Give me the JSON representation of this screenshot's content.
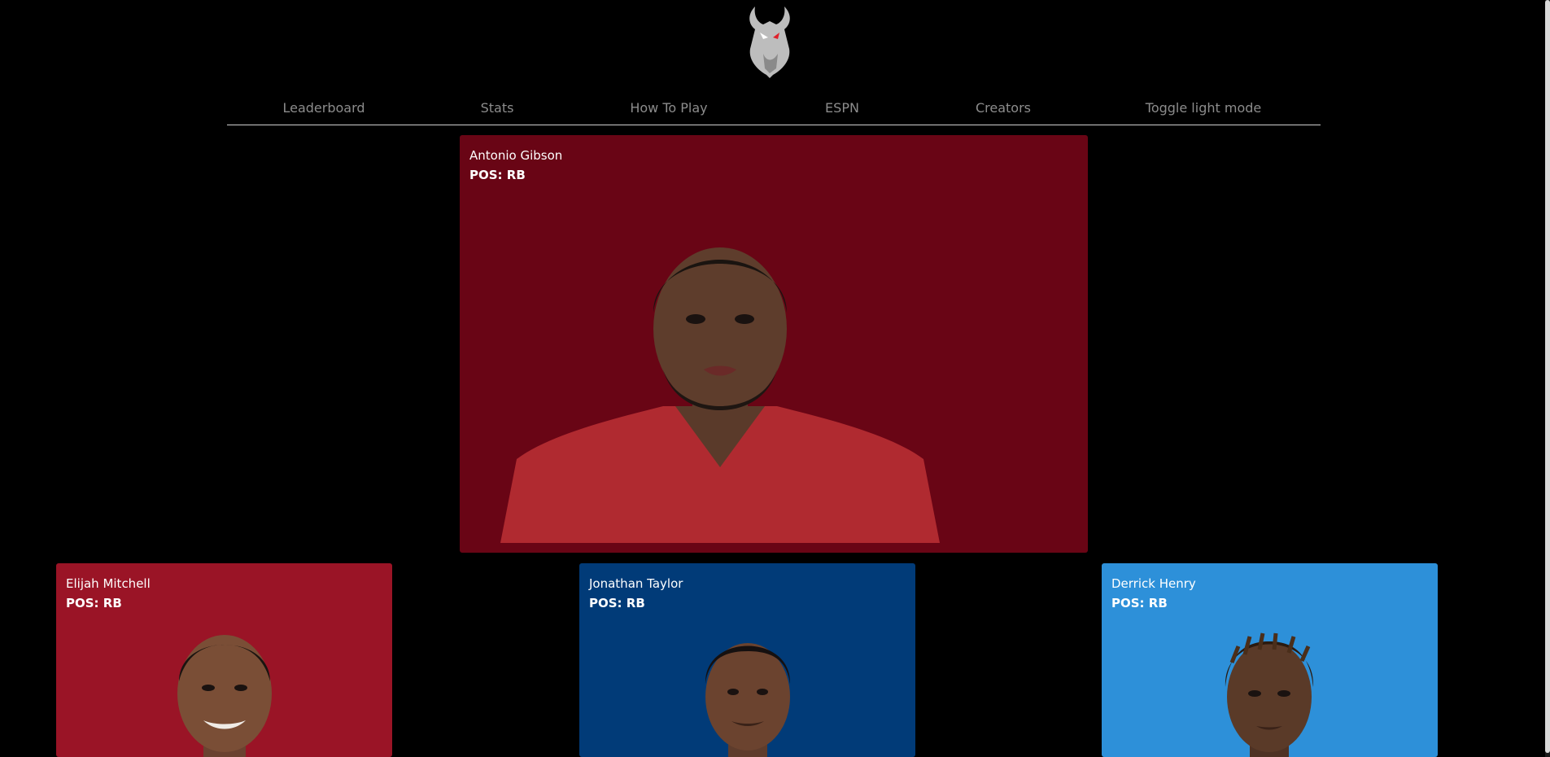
{
  "app": {
    "logo_icon": "goat-logo-icon"
  },
  "nav": {
    "items": [
      {
        "label": "Leaderboard"
      },
      {
        "label": "Stats"
      },
      {
        "label": "How To Play"
      },
      {
        "label": "ESPN"
      },
      {
        "label": "Creators"
      },
      {
        "label": "Toggle light mode"
      }
    ]
  },
  "featured": {
    "name": "Antonio Gibson",
    "position": "POS: RB",
    "background": "#690515",
    "jersey": "#b02a30"
  },
  "options": [
    {
      "name": "Elijah Mitchell",
      "position": "POS: RB",
      "background": "#9a1426",
      "jersey": "#b31e2e"
    },
    {
      "name": "Jonathan Taylor",
      "position": "POS: RB",
      "background": "#013b78",
      "jersey": "#1b4e8a"
    },
    {
      "name": "Derrick Henry",
      "position": "POS: RB",
      "background": "#2d90d9",
      "jersey": "#1b3c5e"
    }
  ]
}
